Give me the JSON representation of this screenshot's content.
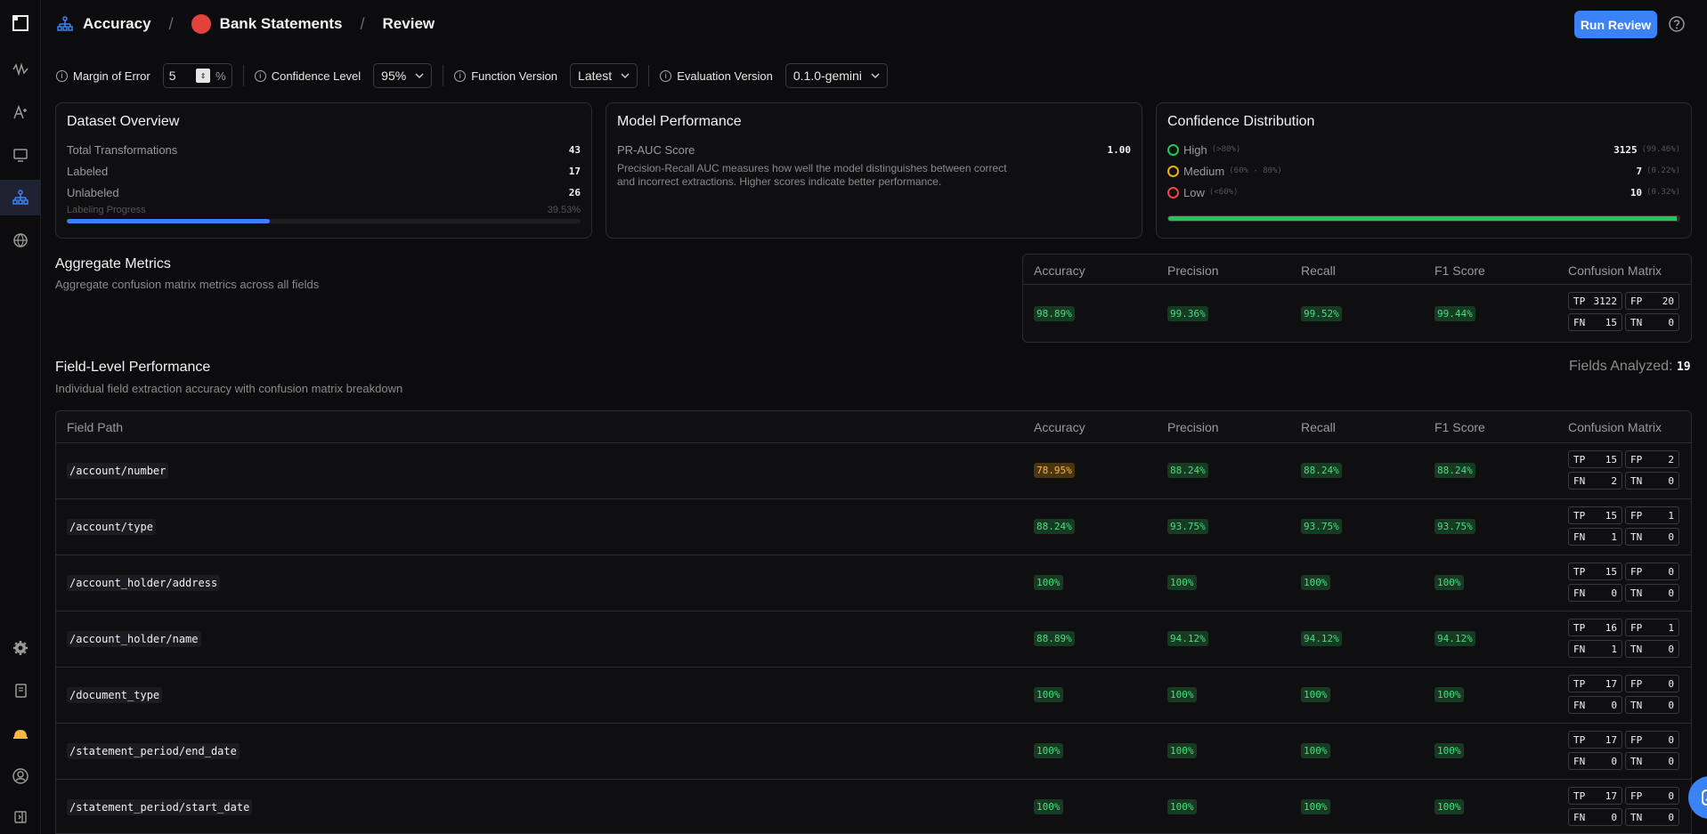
{
  "breadcrumb": {
    "section": "Accuracy",
    "project": "Bank Statements",
    "page": "Review"
  },
  "actions": {
    "run_review": "Run Review"
  },
  "controls": {
    "margin_of_error": {
      "label": "Margin of Error",
      "value": "5",
      "unit": "%"
    },
    "confidence_level": {
      "label": "Confidence Level",
      "value": "95%"
    },
    "function_version": {
      "label": "Function Version",
      "value": "Latest"
    },
    "evaluation_version": {
      "label": "Evaluation Version",
      "value": "0.1.0-gemini"
    }
  },
  "dataset_overview": {
    "title": "Dataset Overview",
    "rows": [
      {
        "label": "Total Transformations",
        "value": "43"
      },
      {
        "label": "Labeled",
        "value": "17"
      },
      {
        "label": "Unlabeled",
        "value": "26"
      }
    ],
    "progress_label": "Labeling Progress",
    "progress_value": "39.53%",
    "progress_fraction": 0.3953
  },
  "model_performance": {
    "title": "Model Performance",
    "metric_label": "PR-AUC Score",
    "metric_value": "1.00",
    "description": "Precision-Recall AUC measures how well the model distinguishes between correct and incorrect extractions. Higher scores indicate better performance."
  },
  "confidence_distribution": {
    "title": "Confidence Distribution",
    "rows": [
      {
        "label": "High",
        "range": "(>80%)",
        "count": "3125",
        "pct": "(99.46%)",
        "color": "#22c55e"
      },
      {
        "label": "Medium",
        "range": "(60% - 80%)",
        "count": "7",
        "pct": "(0.22%)",
        "color": "#eab308"
      },
      {
        "label": "Low",
        "range": "(<60%)",
        "count": "10",
        "pct": "(0.32%)",
        "color": "#ef4444"
      }
    ],
    "high_fraction": 0.9946
  },
  "aggregate": {
    "title": "Aggregate Metrics",
    "subtitle": "Aggregate confusion matrix metrics across all fields",
    "headers": [
      "Accuracy",
      "Precision",
      "Recall",
      "F1 Score",
      "Confusion Matrix"
    ],
    "accuracy": "98.89%",
    "precision": "99.36%",
    "recall": "99.52%",
    "f1": "99.44%",
    "tp": "3122",
    "fp": "20",
    "fn": "15",
    "tn": "0"
  },
  "field_level": {
    "title": "Field-Level Performance",
    "subtitle": "Individual field extraction accuracy with confusion matrix breakdown",
    "count_label": "Fields Analyzed:",
    "count": "19",
    "headers": [
      "Field Path",
      "Accuracy",
      "Precision",
      "Recall",
      "F1 Score",
      "Confusion Matrix"
    ],
    "rows": [
      {
        "path": "/account/number",
        "accuracy": "78.95%",
        "precision": "88.24%",
        "recall": "88.24%",
        "f1": "88.24%",
        "tp": "15",
        "fp": "2",
        "fn": "2",
        "tn": "0"
      },
      {
        "path": "/account/type",
        "accuracy": "88.24%",
        "precision": "93.75%",
        "recall": "93.75%",
        "f1": "93.75%",
        "tp": "15",
        "fp": "1",
        "fn": "1",
        "tn": "0"
      },
      {
        "path": "/account_holder/address",
        "accuracy": "100%",
        "precision": "100%",
        "recall": "100%",
        "f1": "100%",
        "tp": "15",
        "fp": "0",
        "fn": "0",
        "tn": "0"
      },
      {
        "path": "/account_holder/name",
        "accuracy": "88.89%",
        "precision": "94.12%",
        "recall": "94.12%",
        "f1": "94.12%",
        "tp": "16",
        "fp": "1",
        "fn": "1",
        "tn": "0"
      },
      {
        "path": "/document_type",
        "accuracy": "100%",
        "precision": "100%",
        "recall": "100%",
        "f1": "100%",
        "tp": "17",
        "fp": "0",
        "fn": "0",
        "tn": "0"
      },
      {
        "path": "/statement_period/end_date",
        "accuracy": "100%",
        "precision": "100%",
        "recall": "100%",
        "f1": "100%",
        "tp": "17",
        "fp": "0",
        "fn": "0",
        "tn": "0"
      },
      {
        "path": "/statement_period/start_date",
        "accuracy": "100%",
        "precision": "100%",
        "recall": "100%",
        "f1": "100%",
        "tp": "17",
        "fp": "0",
        "fn": "0",
        "tn": "0"
      }
    ]
  },
  "theme": {
    "accent": "#3b82f6",
    "good": "#4ade80",
    "warn": "#f5b942"
  }
}
